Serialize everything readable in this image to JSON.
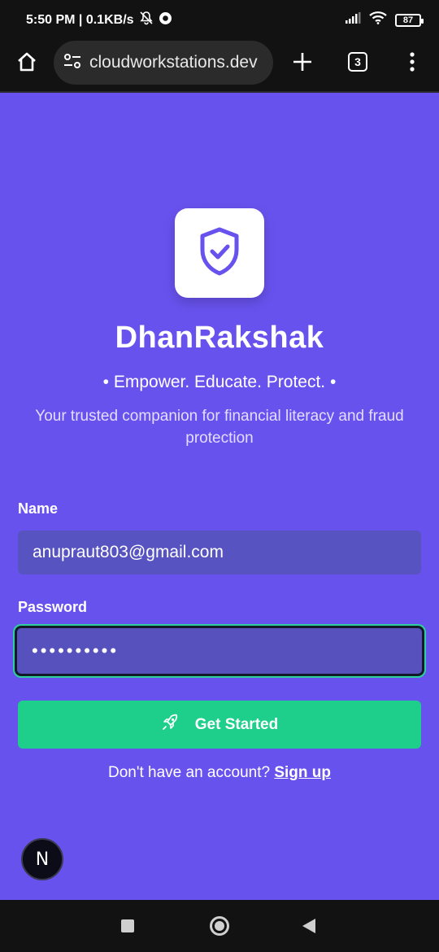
{
  "status_bar": {
    "time_and_speed": "5:50 PM | 0.1KB/s",
    "battery": "87"
  },
  "browser": {
    "url": "cloudworkstations.dev",
    "tab_count": "3"
  },
  "app": {
    "title": "DhanRakshak",
    "tagline": "• Empower. Educate. Protect. •",
    "description": "Your trusted companion for financial literacy and fraud protection"
  },
  "form": {
    "name_label": "Name",
    "name_value": "anupraut803@gmail.com",
    "password_label": "Password",
    "password_value": "••••••••••",
    "submit_label": "Get Started",
    "signup_prompt": "Don't have an account?",
    "signup_link": "Sign up"
  },
  "dev_badge": "N",
  "colors": {
    "background": "#6852ee",
    "accent": "#1ecf8c",
    "field": "#5753c0"
  },
  "icons": [
    "home-icon",
    "site-settings-icon",
    "plus-icon",
    "overflow-menu-icon",
    "shield-check-icon",
    "rocket-icon"
  ]
}
